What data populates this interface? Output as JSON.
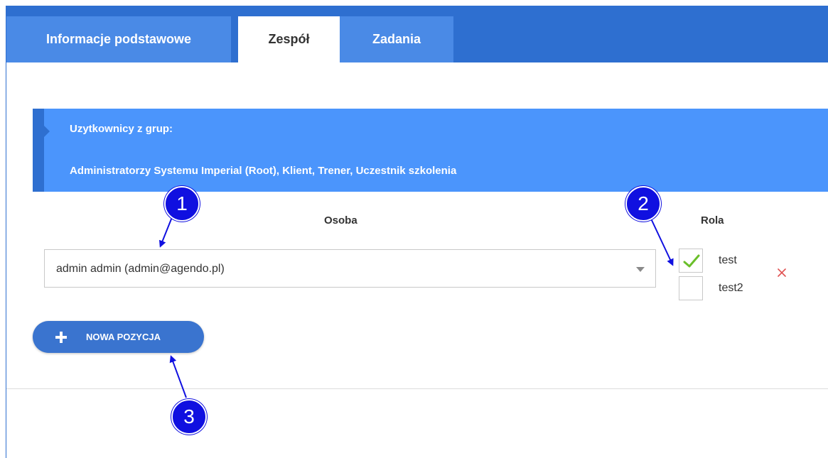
{
  "tabs": [
    {
      "label": "Informacje podstawowe",
      "active": false
    },
    {
      "label": "Zespół",
      "active": true
    },
    {
      "label": "Zadania",
      "active": false
    }
  ],
  "info_box": {
    "title": "Uzytkownicy z grup:",
    "groups": "Administratorzy Systemu Imperial (Root), Klient, Trener, Uczestnik szkolenia"
  },
  "table": {
    "col_person": "Osoba",
    "col_role": "Rola",
    "row": {
      "person": "admin admin (admin@agendo.pl)",
      "roles": [
        {
          "label": "test",
          "checked": true
        },
        {
          "label": "test2",
          "checked": false
        }
      ]
    }
  },
  "add_button": {
    "label": "NOWA POZYCJA"
  },
  "annotations": [
    "1",
    "2",
    "3"
  ],
  "colors": {
    "tab_bar": "#2e6fd0",
    "tab_inactive": "#4a8ae6",
    "info_box": "#4b95fc",
    "button": "#3a74cf",
    "badge": "#1010e0",
    "check": "#6abf2a",
    "remove": "#e05050"
  },
  "icons": [
    "dropdown-caret-icon",
    "check-icon",
    "close-icon",
    "plus-icon"
  ]
}
